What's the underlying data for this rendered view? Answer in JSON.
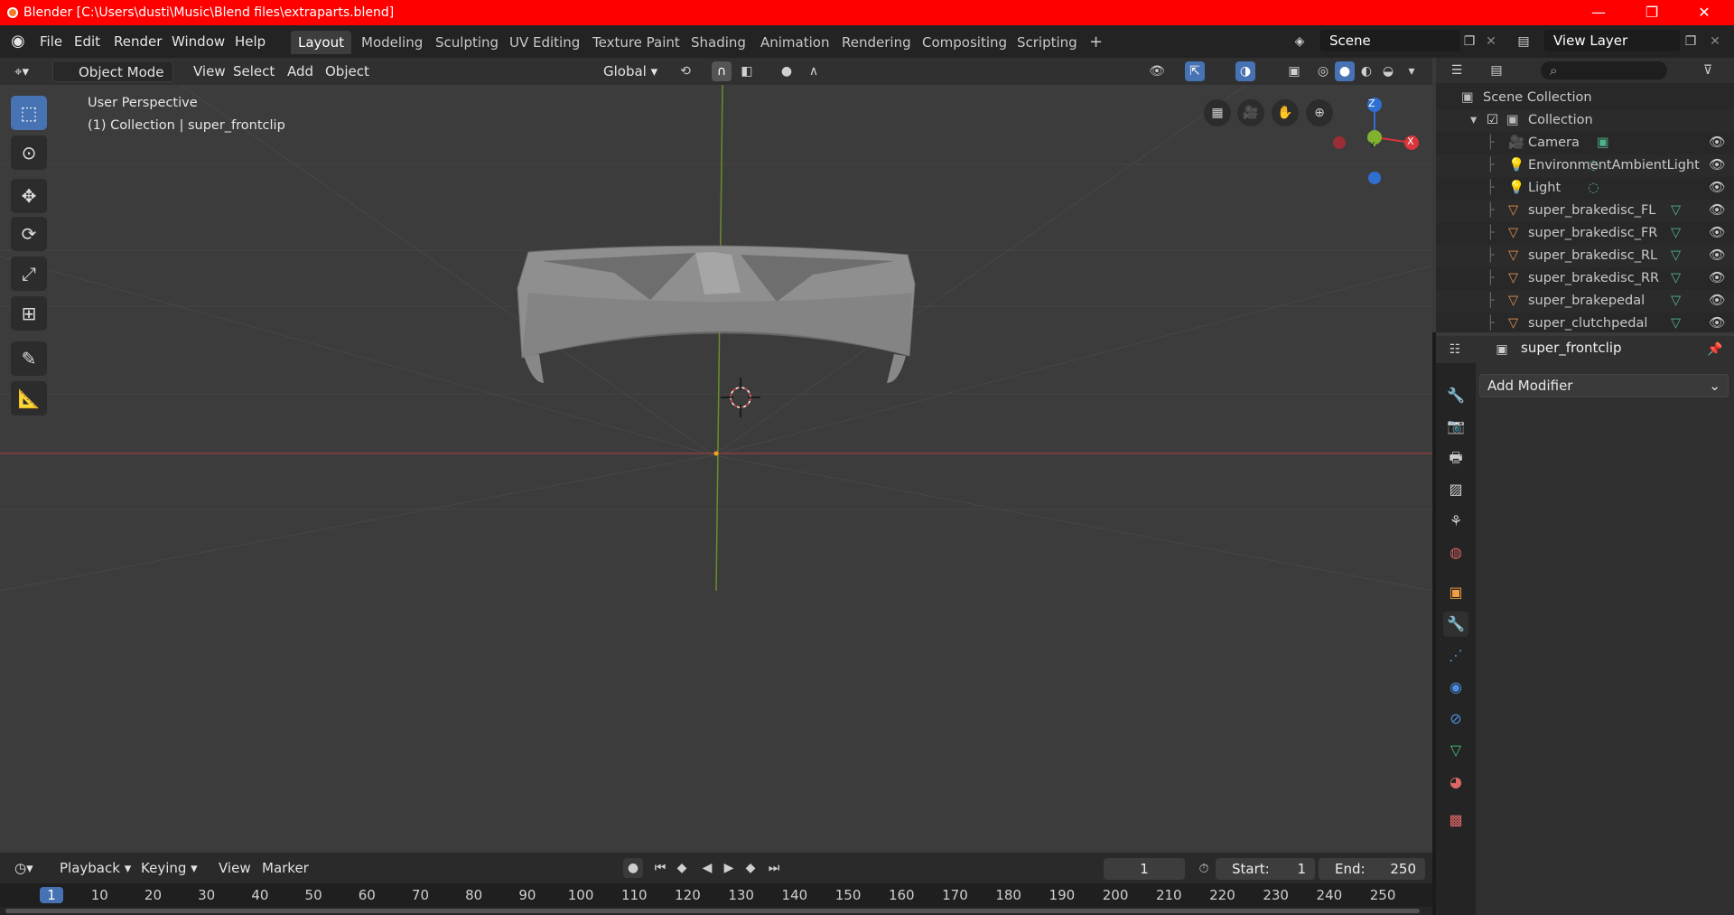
{
  "window": {
    "title": "Blender [C:\\Users\\dusti\\Music\\Blend files\\extraparts.blend]",
    "controls": {
      "minimize": "—",
      "maximize": "❐",
      "close": "✕"
    }
  },
  "menubar": {
    "items": [
      "File",
      "Edit",
      "Render",
      "Window",
      "Help"
    ]
  },
  "workspaces": {
    "tabs": [
      "Layout",
      "Modeling",
      "Sculpting",
      "UV Editing",
      "Texture Paint",
      "Shading",
      "Animation",
      "Rendering",
      "Compositing",
      "Scripting"
    ],
    "active": "Layout",
    "add": "+"
  },
  "scene": {
    "name": "Scene"
  },
  "view_layer": {
    "name": "View Layer"
  },
  "viewport_header": {
    "mode": "Object Mode",
    "menus": [
      "View",
      "Select",
      "Add",
      "Object"
    ],
    "orientation": "Global"
  },
  "viewport": {
    "perspective_label": "User Perspective",
    "collection_label": "(1) Collection | super_frontclip",
    "gizmo": {
      "z": "Z",
      "y": "Y",
      "x": "X"
    }
  },
  "outliner": {
    "search_placeholder": "",
    "root": "Scene Collection",
    "collection": "Collection",
    "items": [
      {
        "name": "Camera",
        "type": "camera"
      },
      {
        "name": "EnvironmentAmbientLight",
        "type": "light"
      },
      {
        "name": "Light",
        "type": "light"
      },
      {
        "name": "super_brakedisc_FL",
        "type": "mesh"
      },
      {
        "name": "super_brakedisc_FR",
        "type": "mesh"
      },
      {
        "name": "super_brakedisc_RL",
        "type": "mesh"
      },
      {
        "name": "super_brakedisc_RR",
        "type": "mesh"
      },
      {
        "name": "super_brakepedal",
        "type": "mesh"
      },
      {
        "name": "super_clutchpedal",
        "type": "mesh"
      }
    ]
  },
  "properties": {
    "object_name": "super_frontclip",
    "add_modifier": "Add Modifier"
  },
  "timeline": {
    "menus": [
      "Playback",
      "Keying",
      "View",
      "Marker"
    ],
    "current_frame": "1",
    "start_label": "Start:",
    "start": "1",
    "end_label": "End:",
    "end": "250",
    "ruler": [
      "1",
      "10",
      "20",
      "30",
      "40",
      "50",
      "60",
      "70",
      "80",
      "90",
      "100",
      "110",
      "120",
      "130",
      "140",
      "150",
      "160",
      "170",
      "180",
      "190",
      "200",
      "210",
      "220",
      "230",
      "240",
      "250"
    ]
  },
  "colors": {
    "title_bar": "#ff0000",
    "accent": "#4772b3",
    "x_axis": "#d9353a",
    "y_axis": "#7fb32f",
    "z_axis": "#2f6fd0"
  }
}
